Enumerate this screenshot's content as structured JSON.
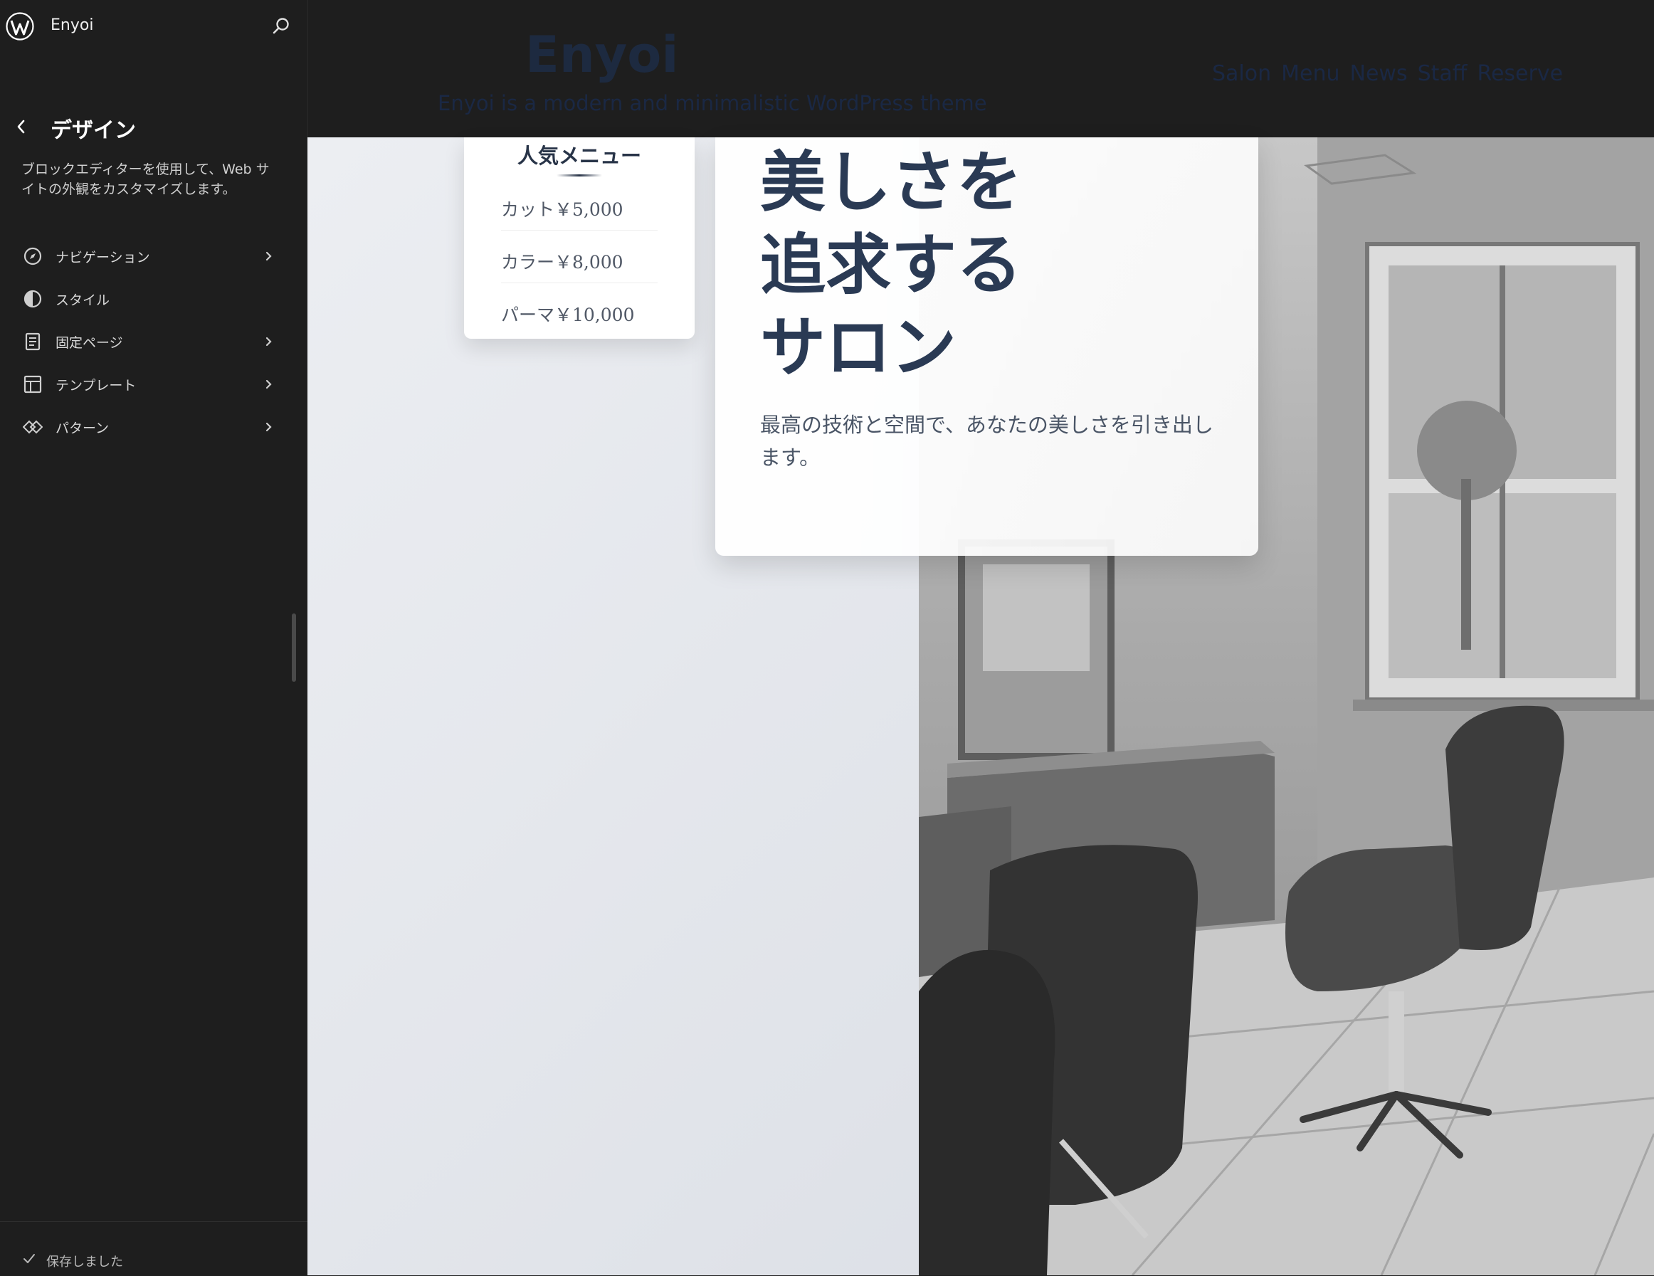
{
  "sidebar": {
    "site_name": "Enyoi",
    "title": "デザイン",
    "description": "ブロックエディターを使用して、Web サイトの外観をカスタマイズします。",
    "items": [
      {
        "label": "ナビゲーション",
        "icon": "navigation-icon",
        "has_chevron": true
      },
      {
        "label": "スタイル",
        "icon": "styles-icon",
        "has_chevron": false
      },
      {
        "label": "固定ページ",
        "icon": "pages-icon",
        "has_chevron": true
      },
      {
        "label": "テンプレート",
        "icon": "template-icon",
        "has_chevron": true
      },
      {
        "label": "パターン",
        "icon": "patterns-icon",
        "has_chevron": true
      }
    ],
    "status": "保存しました"
  },
  "site": {
    "title": "Enyoi",
    "tagline": "Enyoi is a modern and minimalistic WordPress theme",
    "nav": [
      "Salon",
      "Menu",
      "News",
      "Staff",
      "Reserve"
    ]
  },
  "menu_card": {
    "title": "人気メニュー",
    "items": [
      "カット￥5,000",
      "カラー￥8,000",
      "パーマ￥10,000"
    ]
  },
  "hero": {
    "heading_lines": [
      "美しさを",
      "追求する",
      "サロン"
    ],
    "subtitle": "最高の技術と空間で、あなたの美しさを引き出します。"
  },
  "colors": {
    "sidebar_bg": "#1e1e1e",
    "heading": "#2a3a54",
    "site_text": "#1a2844"
  }
}
